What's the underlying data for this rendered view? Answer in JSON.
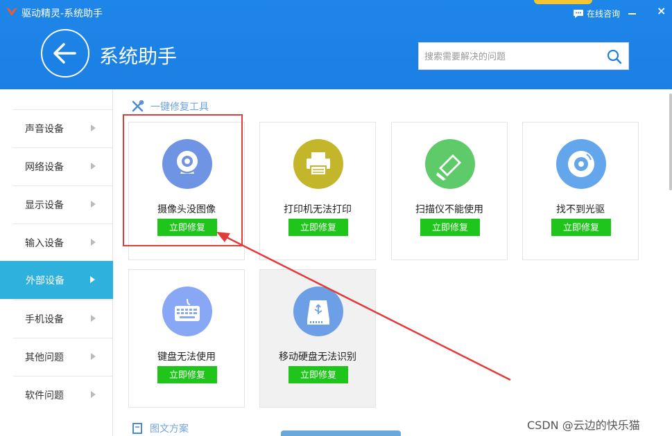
{
  "app": {
    "title": "驱动精灵-系统助手",
    "consult_label": "在线咨询",
    "minimize_label": "",
    "close_label": "×"
  },
  "header": {
    "title": "系统助手"
  },
  "search": {
    "placeholder": "搜索需要解决的问题",
    "value": ""
  },
  "sidebar": {
    "items": [
      {
        "label": "声音设备",
        "active": false
      },
      {
        "label": "网络设备",
        "active": false
      },
      {
        "label": "显示设备",
        "active": false
      },
      {
        "label": "输入设备",
        "active": false
      },
      {
        "label": "外部设备",
        "active": true
      },
      {
        "label": "手机设备",
        "active": false
      },
      {
        "label": "其他问题",
        "active": false
      },
      {
        "label": "软件问题",
        "active": false
      }
    ]
  },
  "main": {
    "section_title": "一键修复工具",
    "bottom_section_title": "图文方案",
    "fix_button_label": "立即修复",
    "tools": [
      {
        "name": "摄像头没图像",
        "icon": "webcam-icon",
        "color": "#6f94e3"
      },
      {
        "name": "打印机无法打印",
        "icon": "printer-icon",
        "color": "#c4b62a"
      },
      {
        "name": "扫描仪不能使用",
        "icon": "scanner-icon",
        "color": "#5fca6a"
      },
      {
        "name": "找不到光驱",
        "icon": "disc-icon",
        "color": "#63a6ec"
      },
      {
        "name": "键盘无法使用",
        "icon": "keyboard-icon",
        "color": "#88a8f5"
      },
      {
        "name": "移动硬盘无法识别",
        "icon": "usb-drive-icon",
        "color": "#6c9fe6"
      }
    ]
  },
  "watermark": "CSDN @云边的快乐猫",
  "colors": {
    "header_blue": "#1f86e9",
    "active_item": "#2fb1dd",
    "fix_green": "#20c51c",
    "highlight_red": "#e33a3a"
  }
}
